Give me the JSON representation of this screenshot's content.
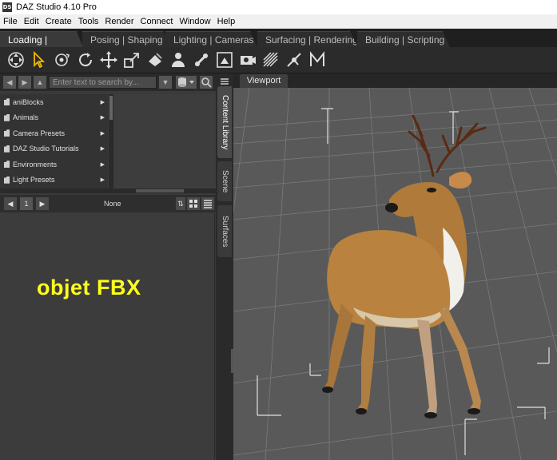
{
  "window": {
    "title": "DAZ Studio 4.10 Pro",
    "icon_text": "DS"
  },
  "menu": [
    "File",
    "Edit",
    "Create",
    "Tools",
    "Render",
    "Connect",
    "Window",
    "Help"
  ],
  "workspace_tabs": [
    "Loading | Creating",
    "Posing | Shaping",
    "Lighting | Cameras",
    "Surfacing | Rendering",
    "Building | Scripting"
  ],
  "toolbar_icons": [
    "universal-tool-icon",
    "select-tool-icon",
    "orbit-tool-icon",
    "rotate-tool-icon",
    "translate-tool-icon",
    "scale-tool-icon",
    "surface-tool-icon",
    "figure-tool-icon",
    "joint-tool-icon",
    "region-tool-icon",
    "camera-tool-icon",
    "geometry-tool-icon",
    "node-tool-icon",
    "mesh-tool-icon"
  ],
  "search": {
    "placeholder": "Enter text to search by..."
  },
  "library_items": [
    "aniBlocks",
    "Animals",
    "Camera Presets",
    "DAZ Studio Tutorials",
    "Environments",
    "Light Presets"
  ],
  "pager": {
    "page": "1",
    "filter_label": "None"
  },
  "side_tabs": [
    "Content Library",
    "Scene",
    "Surfaces"
  ],
  "viewport": {
    "tab_label": "Viewport"
  },
  "overlay": {
    "text": "objet FBX",
    "color": "#ffff1a"
  }
}
